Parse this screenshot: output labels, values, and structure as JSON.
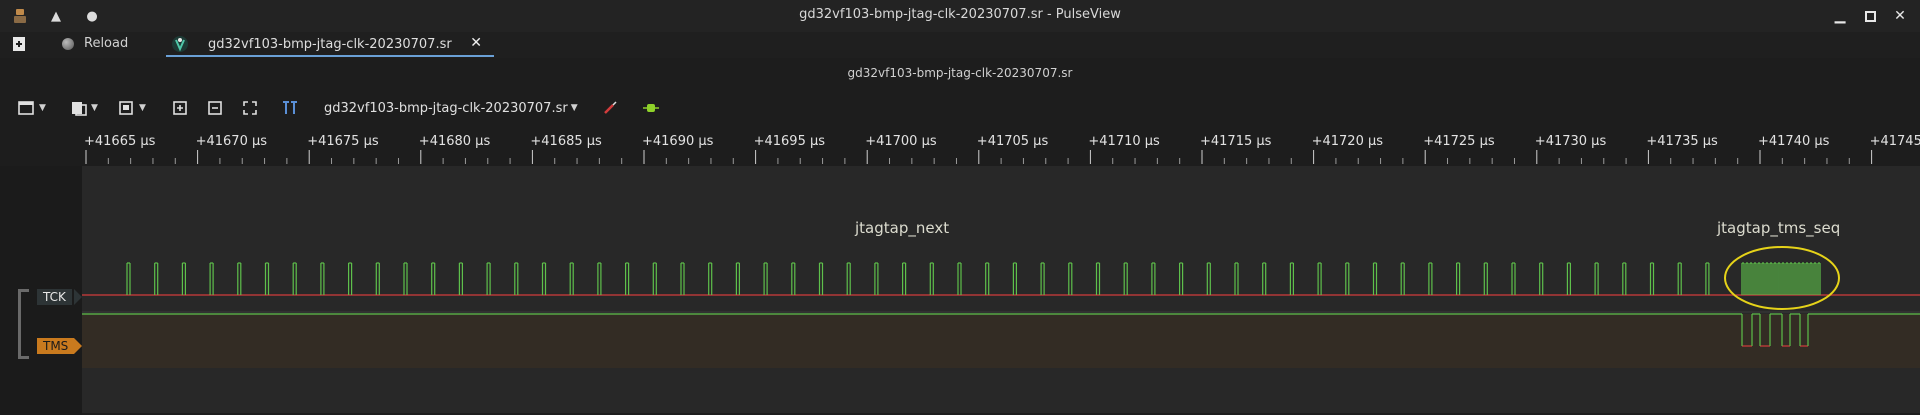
{
  "window": {
    "title": "gd32vf103-bmp-jtag-clk-20230707.sr - PulseView"
  },
  "tabs": {
    "reload_label": "Reload",
    "file_tab_label": "gd32vf103-bmp-jtag-clk-20230707.sr",
    "close_glyph": "✕"
  },
  "session": {
    "title": "gd32vf103-bmp-jtag-clk-20230707.sr"
  },
  "toolbar": {
    "device_label": "gd32vf103-bmp-jtag-clk-20230707.sr"
  },
  "ruler": {
    "ticks": [
      "+41665 µs",
      "+41670 µs",
      "+41675 µs",
      "+41680 µs",
      "+41685 µs",
      "+41690 µs",
      "+41695 µs",
      "+41700 µs",
      "+41705 µs",
      "+41710 µs",
      "+41715 µs",
      "+41720 µs",
      "+41725 µs",
      "+41730 µs",
      "+41735 µs",
      "+41740 µs",
      "+41745 µs"
    ]
  },
  "channels": {
    "tck": {
      "name": "TCK",
      "color": "#2d3436"
    },
    "tms": {
      "name": "TMS",
      "color": "#c97a1e"
    }
  },
  "annotations": {
    "left": "jtagtap_next",
    "right": "jtagtap_tms_seq"
  },
  "colors": {
    "signal_high": "#5ec04b",
    "signal_low": "#d23c3c",
    "highlight": "#e6d319",
    "tab_underline": "#6aa0d6"
  }
}
